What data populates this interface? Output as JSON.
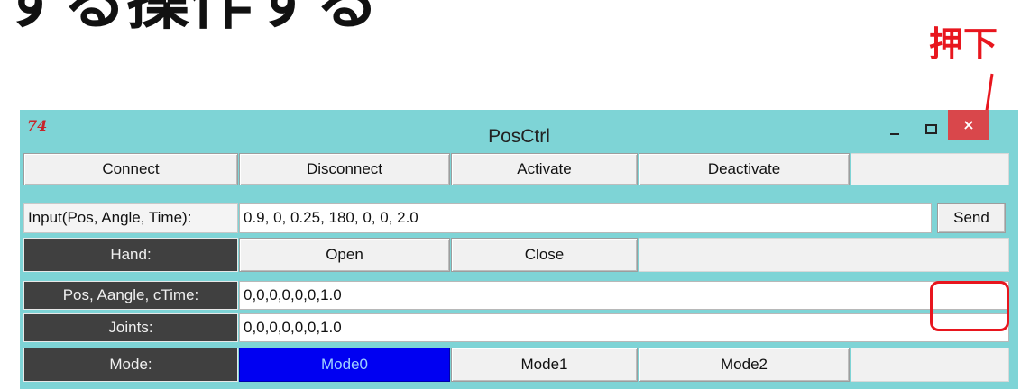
{
  "overlay": {
    "heading_partial": "する操作する",
    "annotation_label": "押下"
  },
  "window": {
    "title": "PosCtrl",
    "app_icon": "74",
    "close_glyph": "×"
  },
  "controls": {
    "connect_label": "Connect",
    "disconnect_label": "Disconnect",
    "activate_label": "Activate",
    "deactivate_label": "Deactivate",
    "input_label": "Input(Pos, Angle, Time):",
    "input_value": "0.9, 0, 0.25, 180, 0, 0, 2.0",
    "send_label": "Send",
    "hand_label": "Hand:",
    "open_label": "Open",
    "close_label": "Close",
    "pos_label": "Pos, Aangle, cTime:",
    "pos_value": "0,0,0,0,0,0,1.0",
    "joints_label": "Joints:",
    "joints_value": "0,0,0,0,0,0,1.0",
    "mode_label": "Mode:",
    "mode_options": [
      "Mode0",
      "Mode1",
      "Mode2"
    ],
    "selected_mode": "Mode0"
  },
  "colors": {
    "window_frame": "#7ed4d6",
    "label_background": "#404040",
    "selected_mode": "#0000f2",
    "annotation_red": "#e8161e",
    "close_button": "#d9474b"
  }
}
